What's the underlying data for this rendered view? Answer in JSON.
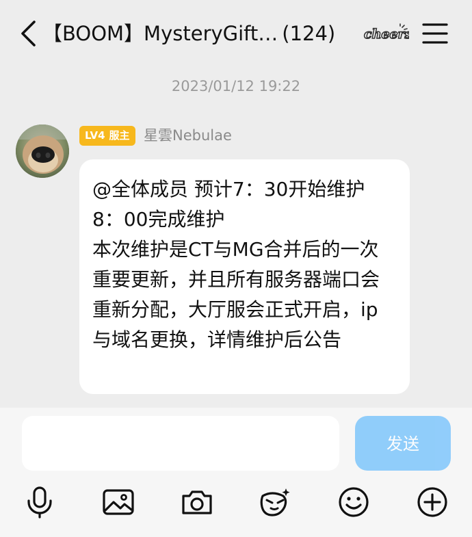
{
  "header": {
    "title": "【BOOM】MysteryGift…",
    "member_count": "(124)",
    "badge_text": "cheers",
    "back_icon": "chevron-left-icon",
    "menu_icon": "hamburger-menu-icon"
  },
  "chat": {
    "timestamp": "2023/01/12 19:22",
    "message": {
      "level": "LV4",
      "role": "服主",
      "sender": "星雲Nebulae",
      "text": "@全体成员 预计7：30开始维护8：00完成维护\n本次维护是CT与MG合并后的一次重要更新，并且所有服务器端口会重新分配，大厅服会正式开启，ip与域名更换，详情维护后公告"
    }
  },
  "composer": {
    "input_value": "",
    "send_label": "发送"
  },
  "toolbar": {
    "items": [
      "microphone-icon",
      "image-icon",
      "camera-icon",
      "sticker-icon",
      "emoji-icon",
      "plus-icon"
    ]
  },
  "colors": {
    "background": "#ededed",
    "send_button": "#7fc6fb",
    "level_badge": "#f7b81d"
  }
}
